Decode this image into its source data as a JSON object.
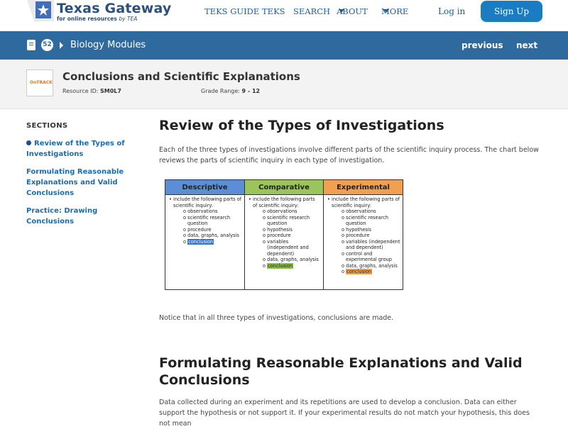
{
  "brand": {
    "name": "Texas Gateway",
    "tagline": "for online resources",
    "tagline_by": "by TEA",
    "color": "#2c4f7c"
  },
  "nav": {
    "items": [
      "TEKS GUIDE",
      "TEKS",
      "SEARCH",
      "ABOUT",
      "MORE"
    ],
    "login": "Log in",
    "signup": "Sign Up"
  },
  "module_bar": {
    "count": "52",
    "title": "Biology Modules",
    "previous": "previous",
    "next": "next",
    "color": "#2e6a9e"
  },
  "resource": {
    "logo_text": "OnTRACK",
    "title": "Conclusions and Scientific Explanations",
    "resource_id_label": "Resource ID:",
    "resource_id": "SM0L7",
    "grade_label": "Grade Range:",
    "grade": "9 - 12"
  },
  "sidebar": {
    "heading": "SECTIONS",
    "items": [
      {
        "label": "Review of the Types of Investigations",
        "active": true
      },
      {
        "label": "Formulating Reasonable Explanations and Valid Conclusions",
        "active": false
      },
      {
        "label": "Practice: Drawing Conclusions",
        "active": false
      }
    ]
  },
  "main": {
    "section1_title": "Review of the Types of Investigations",
    "section1_intro": "Each of the three types of investigations involve different parts of the scientific inquiry process. The chart below reviews the parts of scientific inquiry in each type of investigation.",
    "section1_note": "Notice that in all three types of investigations, conclusions are made.",
    "section2_title": "Formulating Reasonable Explanations and Valid Conclusions",
    "section2_para": "Data collected during an experiment and its repetitions are used to develop a conclusion. Data can either support the hypothesis or not support it. If your experimental results do not match your hypothesis, this does not mean"
  },
  "investigation_chart": {
    "intro": "include the following parts of scientific inquiry:",
    "columns": [
      {
        "title": "Descriptive",
        "color": "#5b8ed6",
        "highlight": "#3b74c4",
        "items": [
          "observations",
          "scientific research question",
          "procedure",
          "data, graphs, analysis",
          "conclusion"
        ]
      },
      {
        "title": "Comparative",
        "color": "#9bc45a",
        "highlight": "#8cbf4a",
        "items": [
          "observations",
          "scientific research question",
          "hypothesis",
          "procedure",
          "variables (independent and dependent)",
          "data, graphs, analysis",
          "conclusion"
        ]
      },
      {
        "title": "Experimental",
        "color": "#f0a050",
        "highlight": "#f0a050",
        "items": [
          "observations",
          "scientific research question",
          "hypothesis",
          "procedure",
          "variables (independent and dependent)",
          "control and experimental group",
          "data, graphs, analysis",
          "conclusion"
        ]
      }
    ]
  }
}
